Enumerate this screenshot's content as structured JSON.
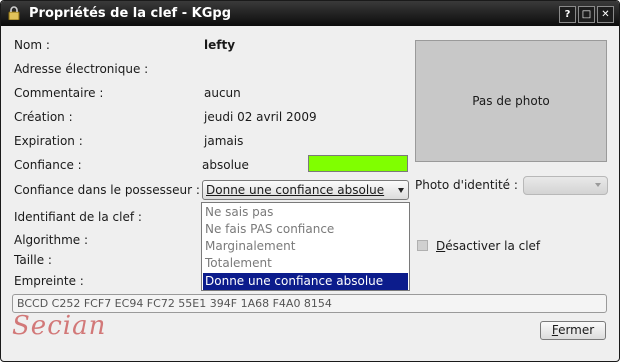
{
  "window": {
    "title": "Propriétés de la clef - KGpg",
    "buttons": {
      "help": "?",
      "maximize": "□",
      "close": "✕"
    }
  },
  "labels": {
    "name": "Nom :",
    "email": "Adresse électronique :",
    "comment": "Commentaire :",
    "creation": "Création :",
    "expiration": "Expiration :",
    "trust": "Confiance :",
    "owner_trust": "Confiance dans le possesseur :",
    "key_id": "Identifiant de la clef :",
    "algorithm": "Algorithme :",
    "size": "Taille :",
    "fingerprint": "Empreinte :"
  },
  "values": {
    "name": "lefty",
    "comment": "aucun",
    "creation": "jeudi 02 avril 2009",
    "expiration": "jamais",
    "trust": "absolue",
    "trust_color": "#80ff00"
  },
  "owner_trust": {
    "selected": "Donne une confiance absolue",
    "options": [
      "Ne sais pas",
      "Ne fais PAS confiance",
      "Marginalement",
      "Totalement",
      "Donne une confiance absolue"
    ],
    "selected_index": 4
  },
  "photo": {
    "placeholder": "Pas de photo",
    "id_label": "Photo d'identité :",
    "id_value": ""
  },
  "disable_key": {
    "mnemonic": "D",
    "rest": "ésactiver la clef",
    "checked": false
  },
  "fingerprint_value": "BCCD C252 FCF7 EC94 FC72 55E1 394F 1A68 F4A0 8154",
  "close_button": {
    "mnemonic": "F",
    "rest": "ermer"
  },
  "watermark": "Secian",
  "colors": {
    "titlebar": "#111111",
    "selection": "#0c1c8c",
    "background": "#efefef"
  },
  "icons": {
    "title": "lock-icon"
  }
}
